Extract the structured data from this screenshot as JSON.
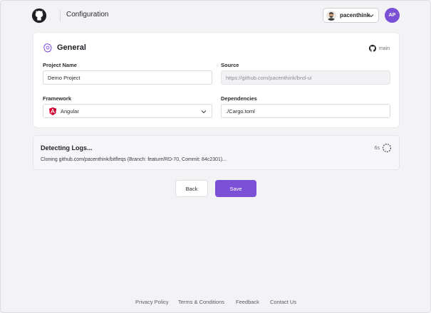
{
  "header": {
    "title": "Configuration",
    "user": {
      "name": "pacenthink"
    },
    "avatar_initials": "AP"
  },
  "general": {
    "title": "General",
    "branch": "main",
    "fields": {
      "project_name": {
        "label": "Project Name",
        "value": "Demo Project"
      },
      "source": {
        "label": "Source",
        "value": "https://github.com/pacenthink/bnd-ui"
      },
      "framework": {
        "label": "Framework",
        "value": "Angular"
      },
      "dependencies": {
        "label": "Dependencies",
        "value": "./Cargo.toml"
      }
    }
  },
  "logs": {
    "title": "Detecting Logs...",
    "elapsed": "6s",
    "line": "Cloning github.com/pacenthink/bitfleqs (Branch: feature/RD-70, Commit: 84c2301)..."
  },
  "actions": {
    "back": "Back",
    "save": "Save"
  },
  "footer": {
    "links": [
      "Privacy Policy",
      "Terms & Conditions",
      "Feedback",
      "Contact Us"
    ]
  },
  "colors": {
    "accent": "#7b4fd6",
    "angular_red": "#dd0031"
  }
}
